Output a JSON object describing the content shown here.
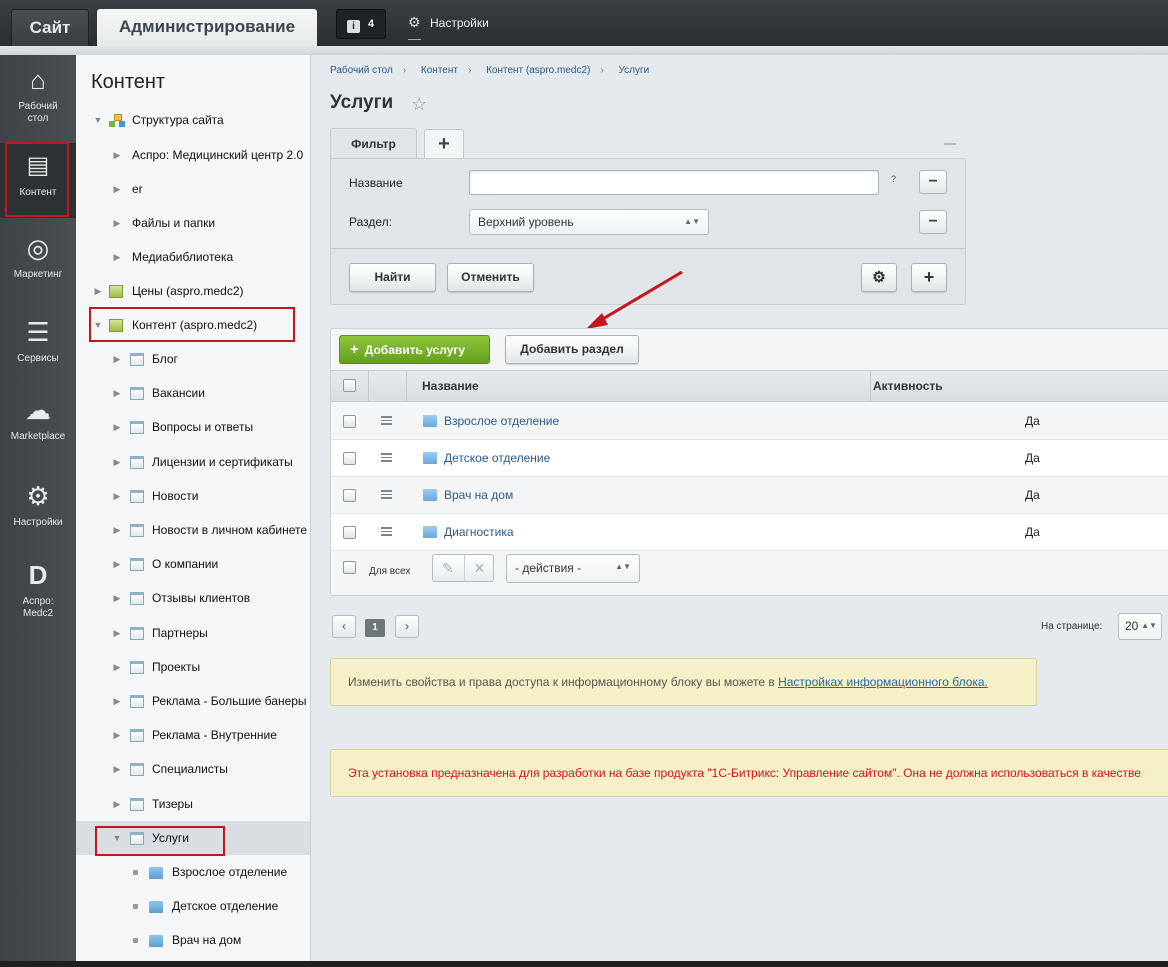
{
  "topbar": {
    "site_tab": "Сайт",
    "admin_tab": "Администрирование",
    "notifications_count": "4",
    "settings_label": "Настройки"
  },
  "leftnav": {
    "items": [
      {
        "label": "Рабочий стол",
        "icon": "home-icon"
      },
      {
        "label": "Контент",
        "icon": "document-icon"
      },
      {
        "label": "Маркетинг",
        "icon": "target-icon"
      },
      {
        "label": "Сервисы",
        "icon": "layers-icon"
      },
      {
        "label": "Marketplace",
        "icon": "cloud-download-icon"
      },
      {
        "label": "Настройки",
        "icon": "gear-icon"
      },
      {
        "label": "Аспро: Medc2",
        "icon": "aspro-logo-icon"
      }
    ]
  },
  "tree": {
    "title": "Контент",
    "items": [
      {
        "label": "Структура сайта"
      },
      {
        "label": "Аспро: Медицинский центр 2.0"
      },
      {
        "label": "er"
      },
      {
        "label": "Файлы и папки"
      },
      {
        "label": "Медиабиблиотека"
      },
      {
        "label": "Цены (aspro.medc2)"
      },
      {
        "label": "Контент (aspro.medc2)"
      },
      {
        "label": "Блог"
      },
      {
        "label": "Вакансии"
      },
      {
        "label": "Вопросы и ответы"
      },
      {
        "label": "Лицензии и сертификаты"
      },
      {
        "label": "Новости"
      },
      {
        "label": "Новости в личном кабинете"
      },
      {
        "label": "О компании"
      },
      {
        "label": "Отзывы клиентов"
      },
      {
        "label": "Партнеры"
      },
      {
        "label": "Проекты"
      },
      {
        "label": "Реклама - Большие банеры"
      },
      {
        "label": "Реклама - Внутренние"
      },
      {
        "label": "Специалисты"
      },
      {
        "label": "Тизеры"
      },
      {
        "label": "Услуги"
      },
      {
        "label": "Взрослое отделение"
      },
      {
        "label": "Детское отделение"
      },
      {
        "label": "Врач на дом"
      }
    ]
  },
  "breadcrumb": [
    "Рабочий стол",
    "Контент",
    "Контент (aspro.medc2)",
    "Услуги"
  ],
  "page": {
    "title": "Услуги"
  },
  "filter": {
    "tab_label": "Фильтр",
    "add_tab": "+",
    "name_label": "Название",
    "name_value": "",
    "help": "?",
    "section_label": "Раздел:",
    "section_value": "Верхний уровень",
    "find_button": "Найти",
    "cancel_button": "Отменить"
  },
  "toolbar": {
    "add_service": "Добавить услугу",
    "add_section": "Добавить раздел"
  },
  "table": {
    "columns": [
      "Название",
      "Активность"
    ],
    "rows": [
      {
        "name": "Взрослое отделение",
        "active": "Да"
      },
      {
        "name": "Детское отделение",
        "active": "Да"
      },
      {
        "name": "Врач на дом",
        "active": "Да"
      },
      {
        "name": "Диагностика",
        "active": "Да"
      }
    ],
    "for_all": "Для всех",
    "actions_placeholder": "- действия -"
  },
  "pager": {
    "prev": "‹",
    "current": "1",
    "next": "›",
    "per_page_label": "На странице:",
    "per_page_value": "20"
  },
  "note": {
    "text": "Изменить свойства и права доступа к информационному блоку вы можете в ",
    "link": "Настройках информационного блока."
  },
  "warning": "Эта установка предназначена для разработки на базе продукта \"1С-Битрикс: Управление сайтом\". Она не должна использоваться в качестве",
  "colors": {
    "accent_green": "#7cb82f",
    "highlight_red": "#c4161c",
    "link_blue": "#2b5a86",
    "warning_red": "#d3151a"
  }
}
